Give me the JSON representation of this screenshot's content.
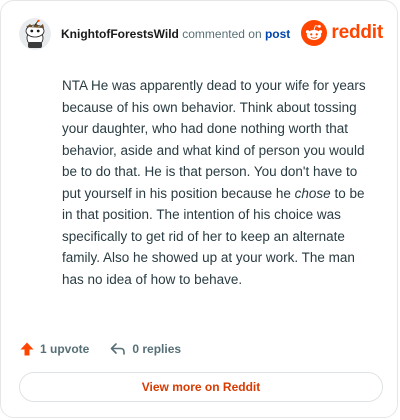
{
  "header": {
    "username": "KnightofForestsWild",
    "action": "commented on",
    "post_link": "post",
    "brand": "reddit"
  },
  "comment": {
    "text_before": "NTA He was apparently dead to your wife for years because of his own behavior. Think about tossing your daughter, who had done nothing worth that behavior, aside and what kind of person you would be to do that. He is that person. You don't have to put yourself in his position because he ",
    "text_emphasis": "chose",
    "text_after": " to be in that position. The intention of his choice was specifically to get rid of her to keep an alternate family. Also he showed up at your work. The man has no idea of how to behave."
  },
  "stats": {
    "upvotes": "1 upvote",
    "replies": "0 replies"
  },
  "view_more": "View more on Reddit",
  "colors": {
    "brand": "#ff4500",
    "link": "#0045ac",
    "cta": "#d93a00",
    "muted": "#576f76"
  }
}
